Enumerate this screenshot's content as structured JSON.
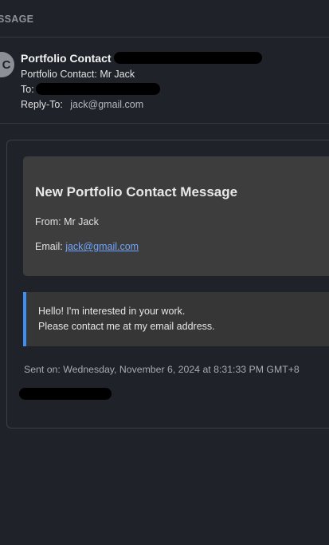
{
  "top_bar": {
    "label": "SSAGE"
  },
  "header": {
    "avatar_letter": "C",
    "sender_name": "Portfolio Contact",
    "subject": "Portfolio Contact: Mr Jack",
    "to_label": "To:",
    "reply_to_label": "Reply-To:",
    "reply_to_value": "jack@gmail.com"
  },
  "message": {
    "title": "New Portfolio Contact Message",
    "from_line": "From: Mr Jack",
    "email_label": "Email: ",
    "email_value": "jack@gmail.com",
    "body_line1": "Hello! I'm interested in your work.",
    "body_line2": "Please contact me at my email address.",
    "sent_on": "Sent on: Wednesday, November 6, 2024 at 8:31:33 PM GMT+8"
  },
  "colors": {
    "background": "#1f2229",
    "card_box": "#3d3d3d",
    "quote_accent": "#3f8ef4",
    "link": "#6fa5ff"
  }
}
